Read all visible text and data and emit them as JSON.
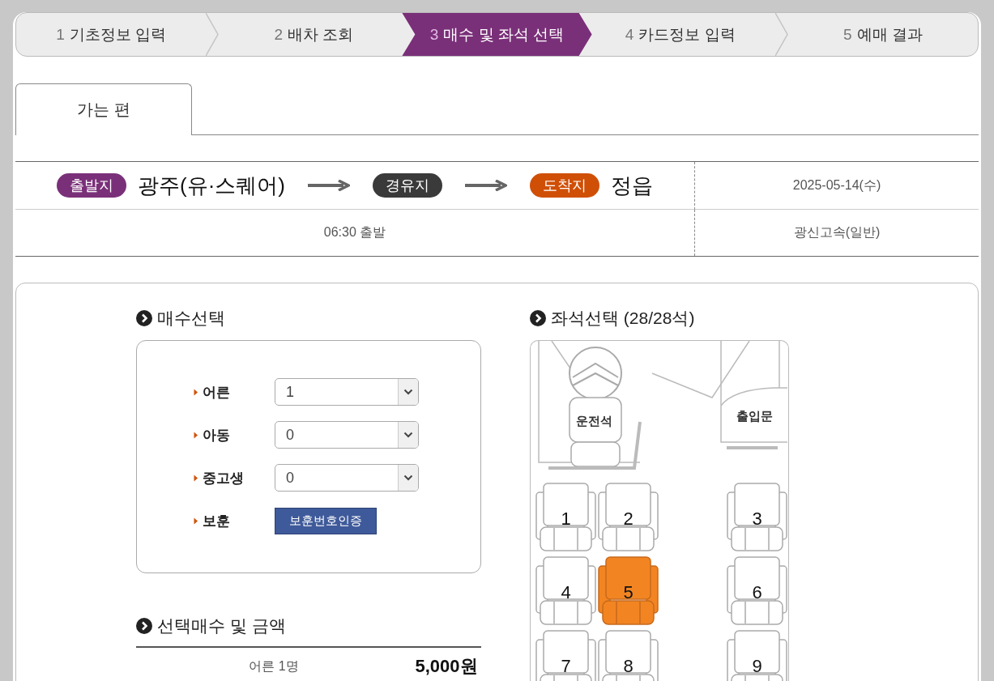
{
  "steps": [
    {
      "number": "1",
      "label": "기초정보 입력",
      "selected": false
    },
    {
      "number": "2",
      "label": "배차 조회",
      "selected": false
    },
    {
      "number": "3",
      "label": "매수 및 좌석 선택",
      "selected": true
    },
    {
      "number": "4",
      "label": "카드정보 입력",
      "selected": false
    },
    {
      "number": "5",
      "label": "예매 결과",
      "selected": false
    }
  ],
  "tabs": [
    {
      "label": "가는 편",
      "selected": true
    }
  ],
  "route": {
    "departure_badge": "출발지",
    "departure": "광주(유·스퀘어)",
    "via_badge": "경유지",
    "arrival_badge": "도착지",
    "arrival": "정읍",
    "date": "2025-05-14(수)",
    "time": "06:30 출발",
    "company": "광신고속(일반)"
  },
  "ticket_count": {
    "title": "매수선택",
    "rows": [
      {
        "label": "어른",
        "kind": "select",
        "value": "1"
      },
      {
        "label": "아동",
        "kind": "select",
        "value": "0"
      },
      {
        "label": "중고생",
        "kind": "select",
        "value": "0"
      },
      {
        "label": "보훈",
        "kind": "button",
        "button": "보훈번호인증"
      }
    ]
  },
  "summary": {
    "title": "선택매수 및 금액",
    "rows": [
      {
        "label": "어른 1명",
        "amount": "5,000원"
      }
    ]
  },
  "seat_map": {
    "title": "좌석선택 (28/28석)",
    "driver_label": "운전석",
    "door_label": "출입문",
    "seats": [
      {
        "number": "1",
        "selected": false
      },
      {
        "number": "2",
        "selected": false
      },
      {
        "number": "3",
        "selected": false
      },
      {
        "number": "4",
        "selected": false
      },
      {
        "number": "5",
        "selected": true
      },
      {
        "number": "6",
        "selected": false
      },
      {
        "number": "7",
        "selected": false
      },
      {
        "number": "8",
        "selected": false
      },
      {
        "number": "9",
        "selected": false
      }
    ]
  }
}
